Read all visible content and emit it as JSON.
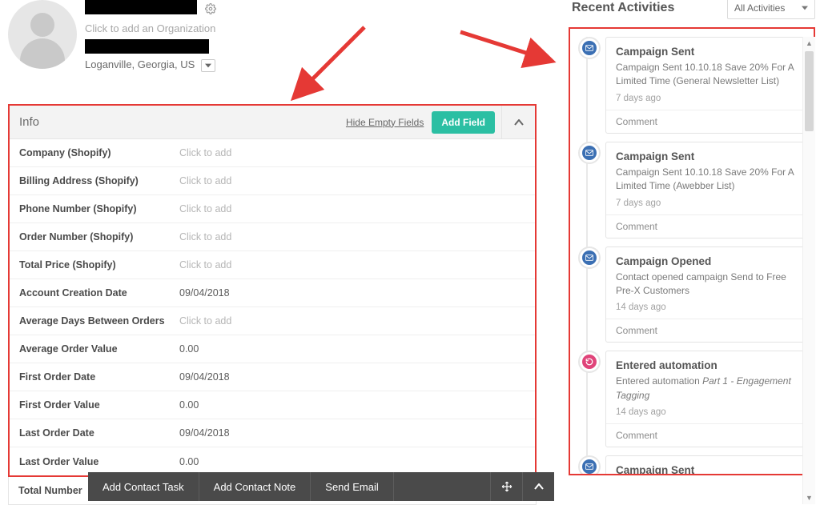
{
  "profile": {
    "org_placeholder": "Click to add an Organization",
    "location_text": "Loganville, Georgia, US"
  },
  "info_panel": {
    "title": "Info",
    "hide_label": "Hide Empty Fields",
    "add_field_label": "Add Field",
    "placeholder": "Click to add",
    "fields": [
      {
        "label": "Company (Shopify)",
        "value": "",
        "placeholder": true
      },
      {
        "label": "Billing Address (Shopify)",
        "value": "",
        "placeholder": true
      },
      {
        "label": "Phone Number (Shopify)",
        "value": "",
        "placeholder": true
      },
      {
        "label": "Order Number (Shopify)",
        "value": "",
        "placeholder": true
      },
      {
        "label": "Total Price (Shopify)",
        "value": "",
        "placeholder": true
      },
      {
        "label": "Account Creation Date",
        "value": "09/04/2018",
        "placeholder": false
      },
      {
        "label": "Average Days Between Orders",
        "value": "",
        "placeholder": true
      },
      {
        "label": "Average Order Value",
        "value": "0.00",
        "placeholder": false
      },
      {
        "label": "First Order Date",
        "value": "09/04/2018",
        "placeholder": false
      },
      {
        "label": "First Order Value",
        "value": "0.00",
        "placeholder": false
      },
      {
        "label": "Last Order Date",
        "value": "09/04/2018",
        "placeholder": false
      },
      {
        "label": "Last Order Value",
        "value": "0.00",
        "placeholder": false
      }
    ],
    "overflow_row_label": "Total Number"
  },
  "recent": {
    "title": "Recent Activities",
    "filter_label": "All Activities",
    "comment_label": "Comment",
    "items": [
      {
        "icon": "mail",
        "title": "Campaign Sent",
        "desc_html": "Campaign Sent 10.10.18 Save 20% For A Limited Time (General Newsletter List)",
        "time": "7 days ago"
      },
      {
        "icon": "mail",
        "title": "Campaign Sent",
        "desc_html": "Campaign Sent 10.10.18 Save 20% For A Limited Time (Awebber List)",
        "time": "7 days ago"
      },
      {
        "icon": "mail",
        "title": "Campaign Opened",
        "desc_html": "Contact opened campaign Send to Free Pre-X Customers",
        "time": "14 days ago"
      },
      {
        "icon": "automation",
        "title": "Entered automation",
        "desc_html": "Entered automation <em>Part 1 - Engagement Tagging</em>",
        "time": "14 days ago"
      },
      {
        "icon": "mail",
        "title": "Campaign Sent",
        "desc_html": "",
        "time": ""
      }
    ]
  },
  "bottom_bar": {
    "add_task": "Add Contact Task",
    "add_note": "Add Contact Note",
    "send_email": "Send Email"
  }
}
